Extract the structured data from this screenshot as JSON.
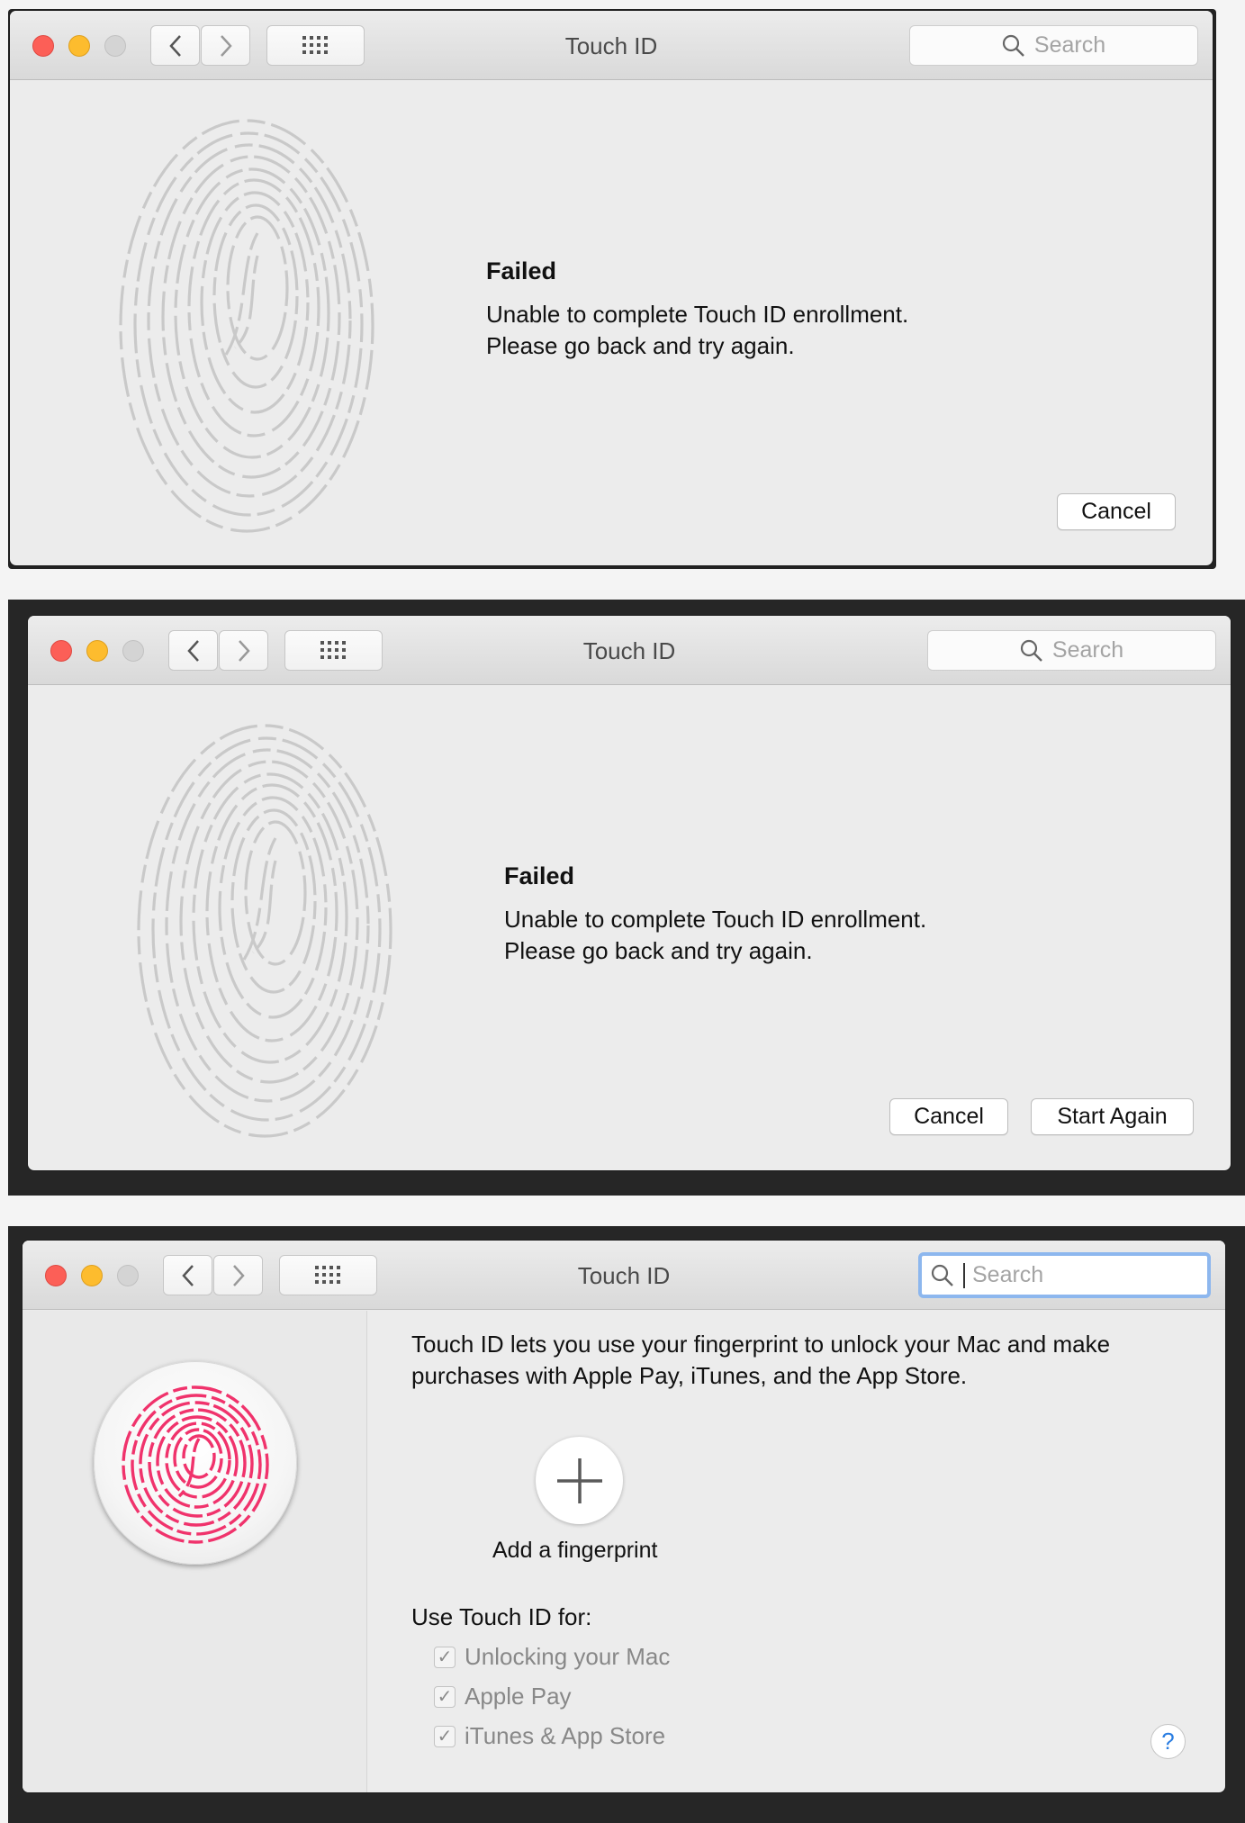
{
  "windows": [
    {
      "title": "Touch ID",
      "search_placeholder": "Search",
      "message_title": "Failed",
      "message_line1": "Unable to complete Touch ID enrollment.",
      "message_line2": "Please go back and try again.",
      "cancel_label": "Cancel"
    },
    {
      "title": "Touch ID",
      "search_placeholder": "Search",
      "message_title": "Failed",
      "message_line1": "Unable to complete Touch ID enrollment.",
      "message_line2": "Please go back and try again.",
      "cancel_label": "Cancel",
      "start_again_label": "Start Again"
    },
    {
      "title": "Touch ID",
      "search_placeholder": "Search",
      "intro_line1": "Touch ID lets you use your fingerprint to unlock your Mac and make",
      "intro_line2": "purchases with Apple Pay, iTunes, and the App Store.",
      "add_fingerprint_label": "Add a fingerprint",
      "use_for_label": "Use Touch ID for:",
      "options": [
        {
          "label": "Unlocking your Mac",
          "checked": true
        },
        {
          "label": "Apple Pay",
          "checked": true
        },
        {
          "label": "iTunes & App Store",
          "checked": true
        }
      ],
      "help_label": "?"
    }
  ],
  "icons": {
    "back": "chevron-left-icon",
    "forward": "chevron-right-icon",
    "grid": "grid-icon",
    "search": "search-icon",
    "fingerprint": "fingerprint-icon",
    "add": "plus-icon",
    "check": "checkmark-icon"
  },
  "colors": {
    "close": "#fc5f57",
    "minimize": "#fdbc2e",
    "fingerprint_active": "#f0336c",
    "fingerprint_inactive": "#c9c9c9",
    "focus_ring": "#8db7ee"
  }
}
